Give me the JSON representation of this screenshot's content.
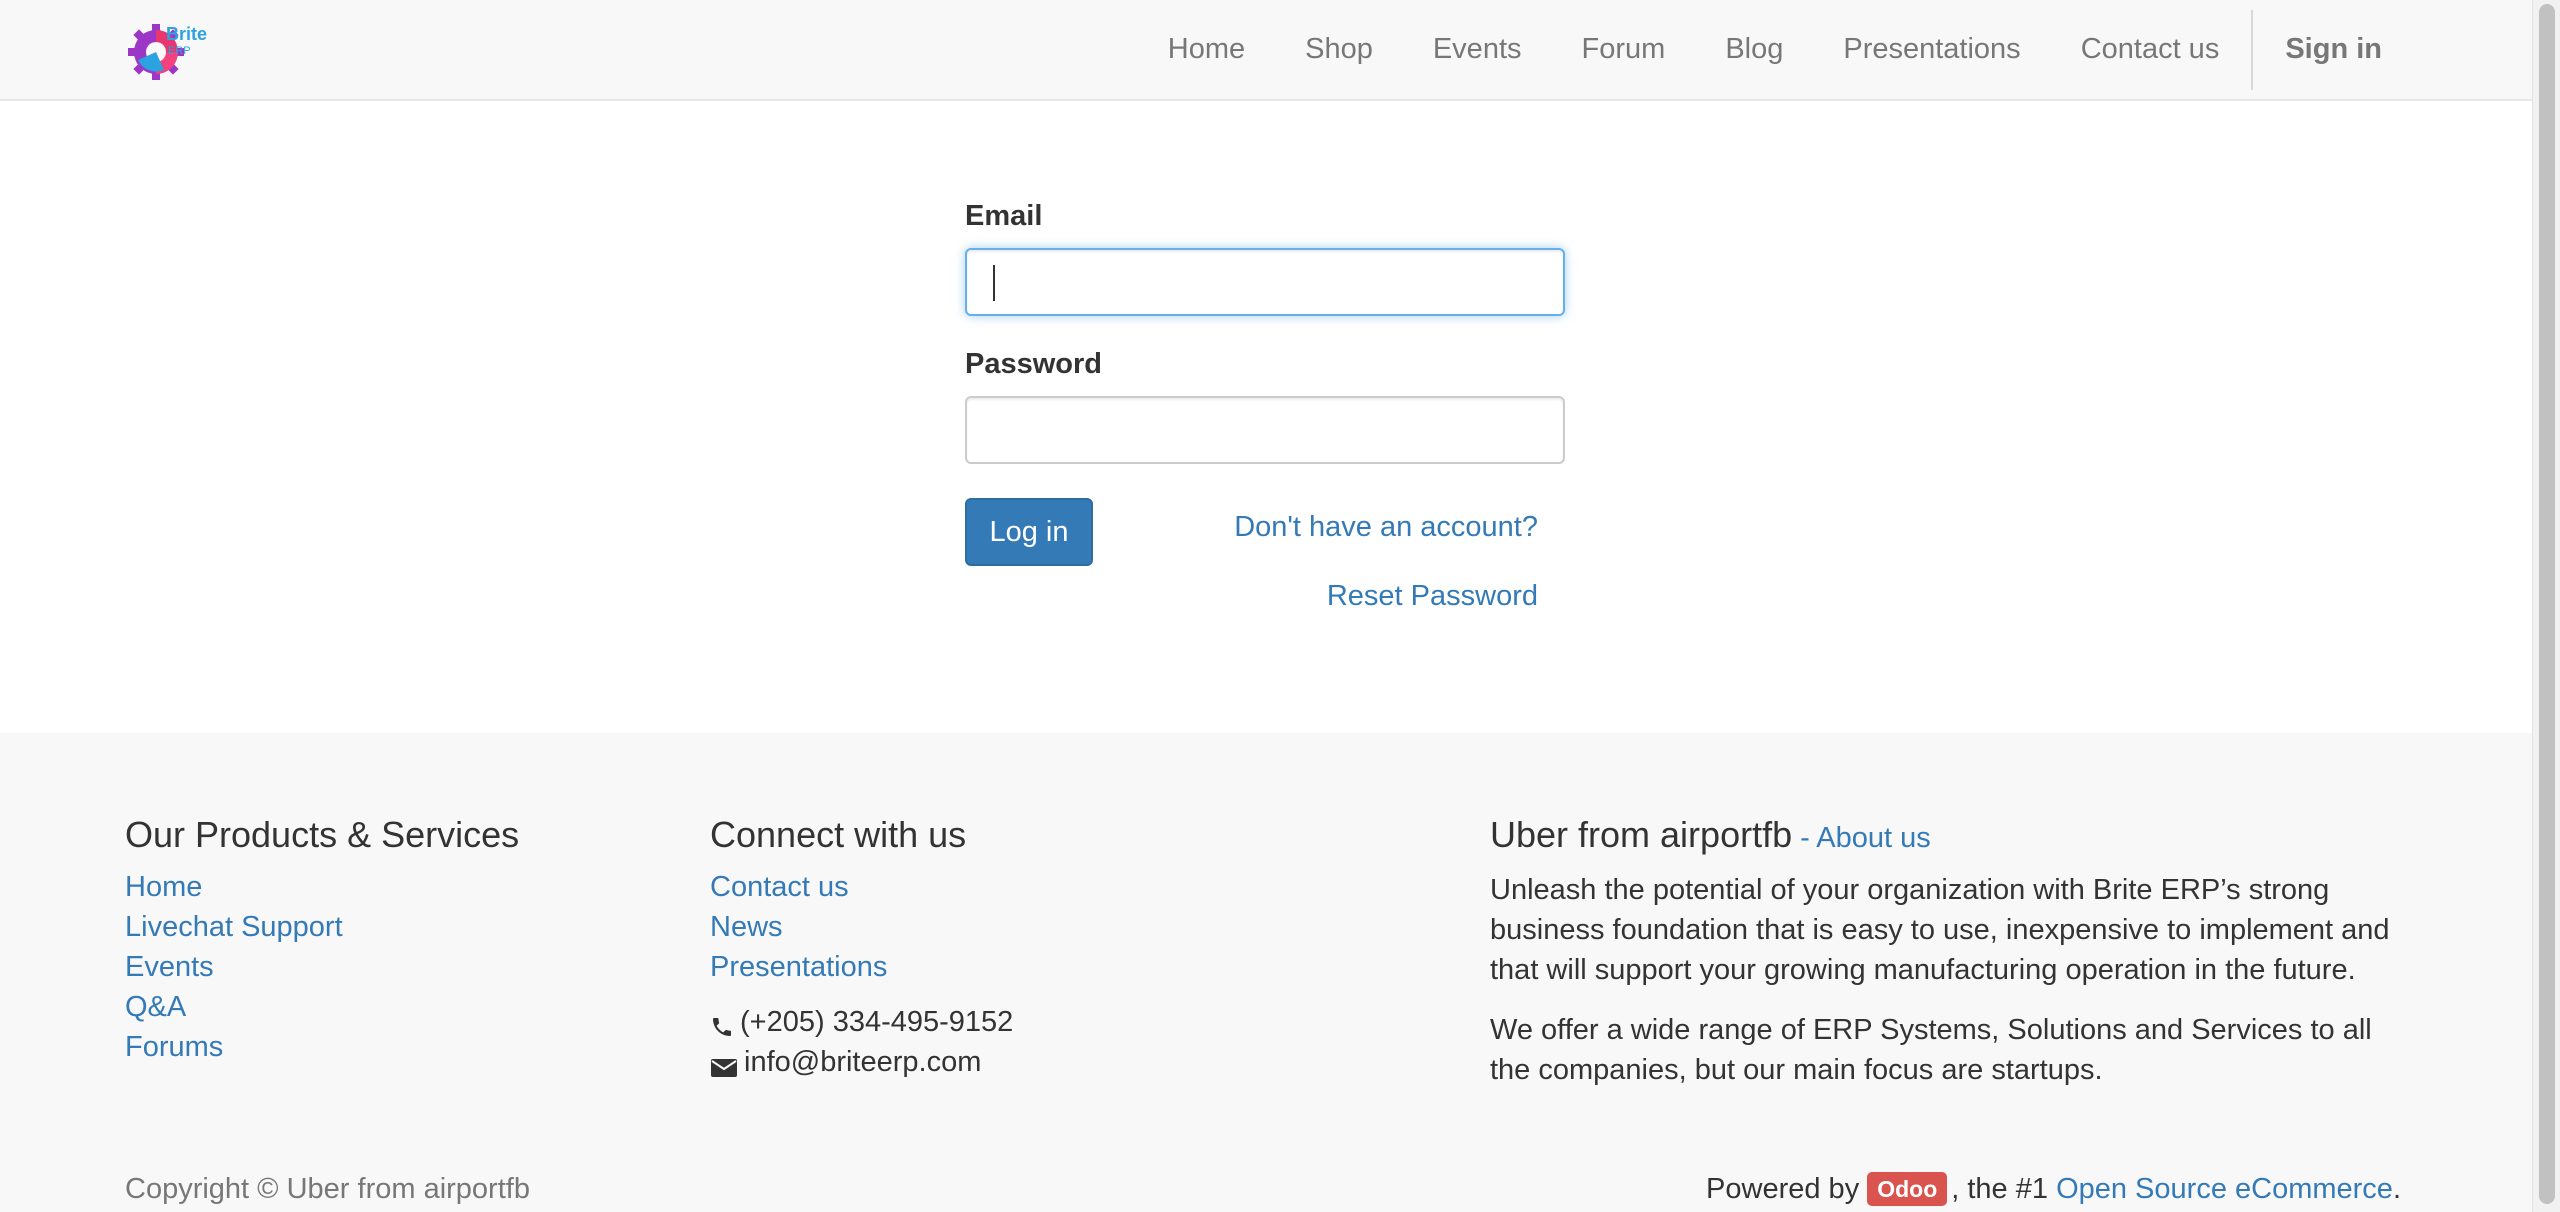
{
  "nav": {
    "logo_text": "Brite ERP",
    "items": [
      {
        "label": "Home"
      },
      {
        "label": "Shop"
      },
      {
        "label": "Events"
      },
      {
        "label": "Forum"
      },
      {
        "label": "Blog"
      },
      {
        "label": "Presentations"
      },
      {
        "label": "Contact us"
      }
    ],
    "signin_label": "Sign in"
  },
  "login": {
    "email_label": "Email",
    "email_value": "",
    "password_label": "Password",
    "password_value": "",
    "login_button": "Log in",
    "signup_link": "Don't have an account?",
    "reset_link": "Reset Password"
  },
  "footer": {
    "products": {
      "heading": "Our Products & Services",
      "links": [
        "Home",
        "Livechat Support",
        "Events",
        "Q&A",
        "Forums"
      ]
    },
    "connect": {
      "heading": "Connect with us",
      "links": [
        "Contact us",
        "News",
        "Presentations"
      ],
      "phone": "(+205) 334-495-9152",
      "email": "info@briteerp.com",
      "phone_icon": "phone-icon",
      "email_icon": "envelope-icon"
    },
    "about": {
      "heading": "Uber from airportfb",
      "about_link": "About us",
      "about_separator": " - ",
      "paragraph_1": "Unleash the potential of your organization with Brite ERP’s strong business foundation that is easy to use, inexpensive to implement and that will support your growing manufacturing operation in the future.",
      "paragraph_2": "We offer a wide range of ERP Systems, Solutions and Services to all the companies, but our main focus are startups."
    },
    "copyright": "Copyright © Uber from airportfb",
    "powered_prefix": "Powered by",
    "powered_badge": "Odoo",
    "powered_middle": ", the #1",
    "powered_link": "Open Source eCommerce",
    "powered_suffix": "."
  },
  "colors": {
    "link": "#337ab7",
    "primary_button": "#337ab7",
    "badge": "#d9534f",
    "navbar_bg": "#f8f8f8"
  }
}
